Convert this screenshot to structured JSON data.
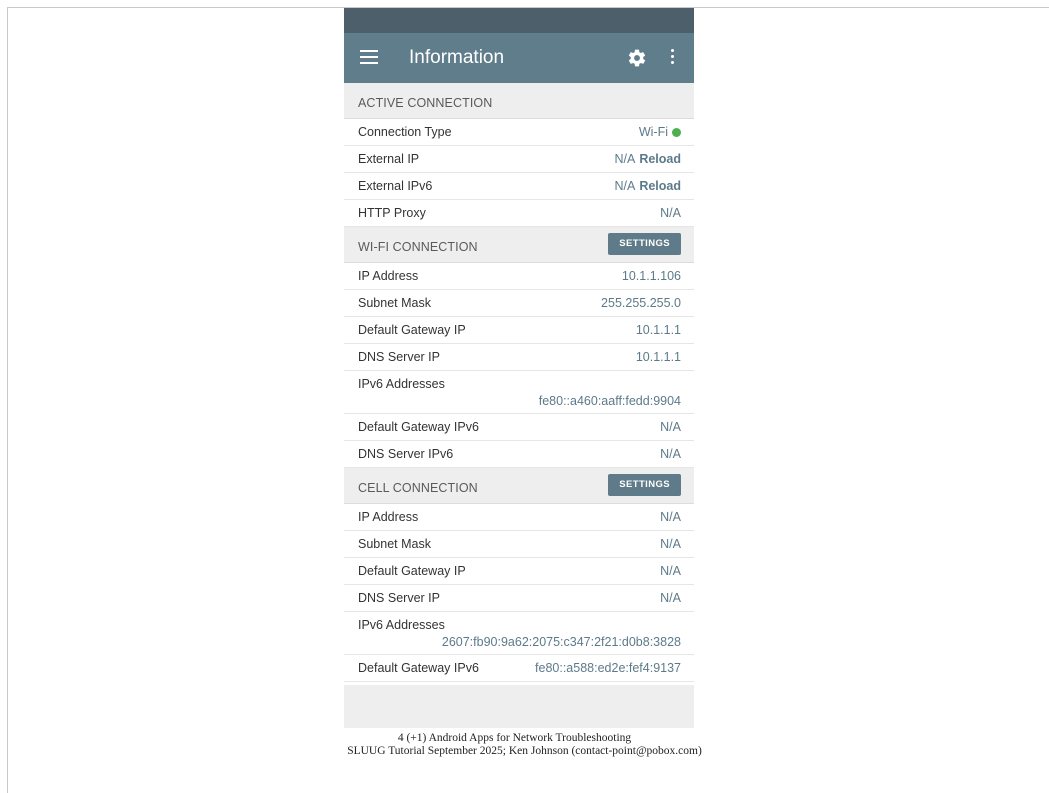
{
  "app": {
    "title": "Information",
    "menu_icon": "hamburger-menu-icon",
    "settings_icon": "gear-icon",
    "overflow_icon": "more-vert-icon"
  },
  "active": {
    "header": "ACTIVE CONNECTION",
    "rows": [
      {
        "key": "Connection Type",
        "value": "Wi-Fi",
        "status_color": "#4caf50"
      },
      {
        "key": "External IP",
        "value": "N/A",
        "action": "Reload"
      },
      {
        "key": "External IPv6",
        "value": "N/A",
        "action": "Reload"
      },
      {
        "key": "HTTP Proxy",
        "value": "N/A"
      }
    ]
  },
  "wifi": {
    "header": "WI-FI CONNECTION",
    "settings_label": "SETTINGS",
    "rows": [
      {
        "key": "IP Address",
        "value": "10.1.1.106"
      },
      {
        "key": "Subnet Mask",
        "value": "255.255.255.0"
      },
      {
        "key": "Default Gateway IP",
        "value": "10.1.1.1"
      },
      {
        "key": "DNS Server IP",
        "value": "10.1.1.1"
      },
      {
        "key": "IPv6 Addresses",
        "value": "fe80::a460:aaff:fedd:9904"
      },
      {
        "key": "Default Gateway IPv6",
        "value": "N/A"
      },
      {
        "key": "DNS Server IPv6",
        "value": "N/A"
      }
    ]
  },
  "cell": {
    "header": "CELL CONNECTION",
    "settings_label": "SETTINGS",
    "rows": [
      {
        "key": "IP Address",
        "value": "N/A"
      },
      {
        "key": "Subnet Mask",
        "value": "N/A"
      },
      {
        "key": "Default Gateway IP",
        "value": "N/A"
      },
      {
        "key": "DNS Server IP",
        "value": "N/A"
      },
      {
        "key": "IPv6 Addresses",
        "value": "2607:fb90:9a62:2075:c347:2f21:d0b8:3828"
      },
      {
        "key": "Default Gateway IPv6",
        "value": "fe80::a588:ed2e:fef4:9137"
      }
    ]
  },
  "caption": {
    "line1": "4 (+1) Android Apps for Network Troubleshooting",
    "line2": "SLUUG Tutorial September 2025;  Ken Johnson  (contact-point@pobox.com)"
  },
  "colors": {
    "appbar": "#607d8b",
    "statusbar": "#4d5f6b",
    "value_text": "#5d7a8a",
    "settings_button": "#5f7b89"
  }
}
